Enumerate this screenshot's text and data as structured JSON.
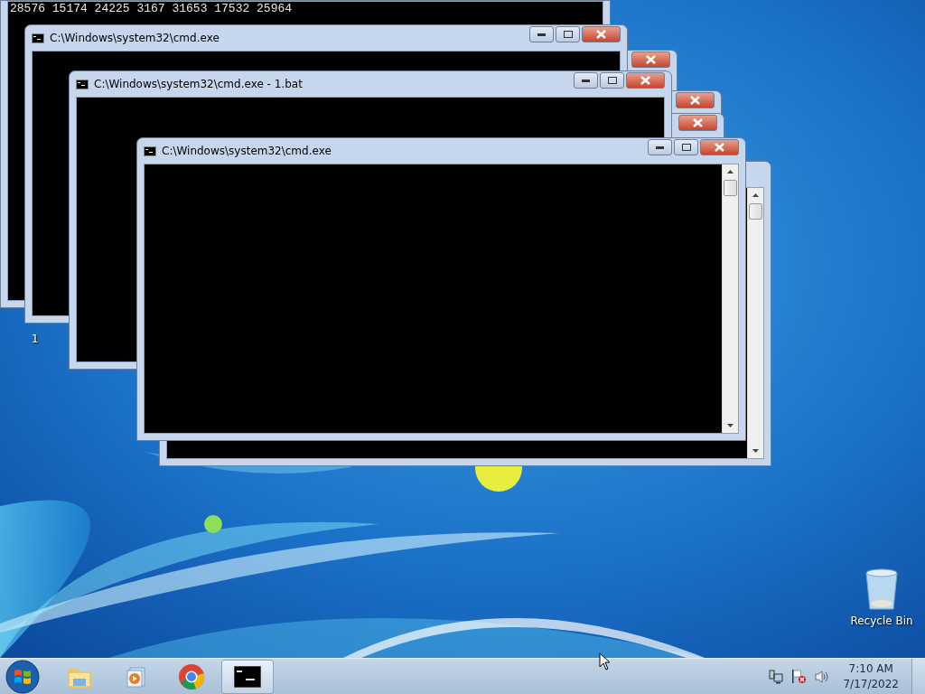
{
  "windows": [
    {
      "kind": "ghost"
    },
    {
      "kind": "ghost"
    },
    {
      "kind": "ghost"
    },
    {
      "kind": "frame"
    },
    {
      "kind": "console_body",
      "lines": [
        "28576 15174 24225 3167 31653 17532 25964"
      ]
    },
    {
      "kind": "console_partial",
      "title": "C:\\Windows\\system32\\cmd.exe"
    },
    {
      "kind": "console_partial",
      "title": "C:\\Windows\\system32\\cmd.exe - 1.bat"
    },
    {
      "kind": "console",
      "title": "C:\\Windows\\system32\\cmd.exe"
    }
  ],
  "desktop_text": "1",
  "desktop_icons": [
    {
      "label": "Recycle Bin"
    }
  ],
  "taskbar": {
    "pinned": [
      {
        "kind": "explorer",
        "selected": false
      },
      {
        "kind": "media",
        "selected": false
      },
      {
        "kind": "chrome",
        "selected": false
      },
      {
        "kind": "cmd",
        "selected": true
      }
    ],
    "clock": {
      "time": "7:10 AM",
      "date": "7/17/2022"
    }
  }
}
